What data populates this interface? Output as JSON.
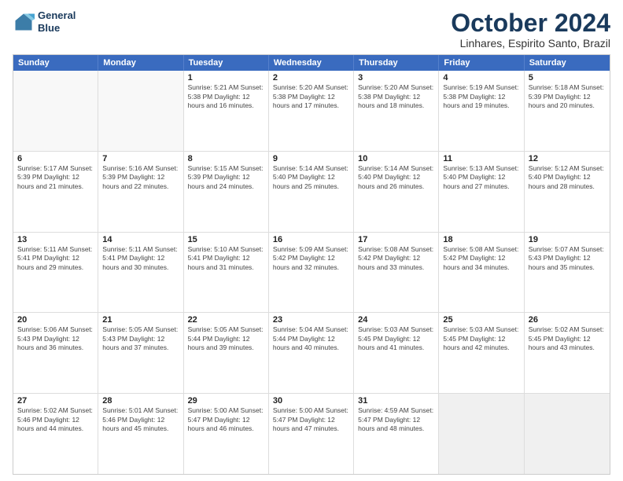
{
  "header": {
    "logo_line1": "General",
    "logo_line2": "Blue",
    "month": "October 2024",
    "location": "Linhares, Espirito Santo, Brazil"
  },
  "days_of_week": [
    "Sunday",
    "Monday",
    "Tuesday",
    "Wednesday",
    "Thursday",
    "Friday",
    "Saturday"
  ],
  "weeks": [
    [
      {
        "day": "",
        "info": "",
        "empty": true
      },
      {
        "day": "",
        "info": "",
        "empty": true
      },
      {
        "day": "1",
        "info": "Sunrise: 5:21 AM\nSunset: 5:38 PM\nDaylight: 12 hours\nand 16 minutes."
      },
      {
        "day": "2",
        "info": "Sunrise: 5:20 AM\nSunset: 5:38 PM\nDaylight: 12 hours\nand 17 minutes."
      },
      {
        "day": "3",
        "info": "Sunrise: 5:20 AM\nSunset: 5:38 PM\nDaylight: 12 hours\nand 18 minutes."
      },
      {
        "day": "4",
        "info": "Sunrise: 5:19 AM\nSunset: 5:38 PM\nDaylight: 12 hours\nand 19 minutes."
      },
      {
        "day": "5",
        "info": "Sunrise: 5:18 AM\nSunset: 5:39 PM\nDaylight: 12 hours\nand 20 minutes."
      }
    ],
    [
      {
        "day": "6",
        "info": "Sunrise: 5:17 AM\nSunset: 5:39 PM\nDaylight: 12 hours\nand 21 minutes."
      },
      {
        "day": "7",
        "info": "Sunrise: 5:16 AM\nSunset: 5:39 PM\nDaylight: 12 hours\nand 22 minutes."
      },
      {
        "day": "8",
        "info": "Sunrise: 5:15 AM\nSunset: 5:39 PM\nDaylight: 12 hours\nand 24 minutes."
      },
      {
        "day": "9",
        "info": "Sunrise: 5:14 AM\nSunset: 5:40 PM\nDaylight: 12 hours\nand 25 minutes."
      },
      {
        "day": "10",
        "info": "Sunrise: 5:14 AM\nSunset: 5:40 PM\nDaylight: 12 hours\nand 26 minutes."
      },
      {
        "day": "11",
        "info": "Sunrise: 5:13 AM\nSunset: 5:40 PM\nDaylight: 12 hours\nand 27 minutes."
      },
      {
        "day": "12",
        "info": "Sunrise: 5:12 AM\nSunset: 5:40 PM\nDaylight: 12 hours\nand 28 minutes."
      }
    ],
    [
      {
        "day": "13",
        "info": "Sunrise: 5:11 AM\nSunset: 5:41 PM\nDaylight: 12 hours\nand 29 minutes."
      },
      {
        "day": "14",
        "info": "Sunrise: 5:11 AM\nSunset: 5:41 PM\nDaylight: 12 hours\nand 30 minutes."
      },
      {
        "day": "15",
        "info": "Sunrise: 5:10 AM\nSunset: 5:41 PM\nDaylight: 12 hours\nand 31 minutes."
      },
      {
        "day": "16",
        "info": "Sunrise: 5:09 AM\nSunset: 5:42 PM\nDaylight: 12 hours\nand 32 minutes."
      },
      {
        "day": "17",
        "info": "Sunrise: 5:08 AM\nSunset: 5:42 PM\nDaylight: 12 hours\nand 33 minutes."
      },
      {
        "day": "18",
        "info": "Sunrise: 5:08 AM\nSunset: 5:42 PM\nDaylight: 12 hours\nand 34 minutes."
      },
      {
        "day": "19",
        "info": "Sunrise: 5:07 AM\nSunset: 5:43 PM\nDaylight: 12 hours\nand 35 minutes."
      }
    ],
    [
      {
        "day": "20",
        "info": "Sunrise: 5:06 AM\nSunset: 5:43 PM\nDaylight: 12 hours\nand 36 minutes."
      },
      {
        "day": "21",
        "info": "Sunrise: 5:05 AM\nSunset: 5:43 PM\nDaylight: 12 hours\nand 37 minutes."
      },
      {
        "day": "22",
        "info": "Sunrise: 5:05 AM\nSunset: 5:44 PM\nDaylight: 12 hours\nand 39 minutes."
      },
      {
        "day": "23",
        "info": "Sunrise: 5:04 AM\nSunset: 5:44 PM\nDaylight: 12 hours\nand 40 minutes."
      },
      {
        "day": "24",
        "info": "Sunrise: 5:03 AM\nSunset: 5:45 PM\nDaylight: 12 hours\nand 41 minutes."
      },
      {
        "day": "25",
        "info": "Sunrise: 5:03 AM\nSunset: 5:45 PM\nDaylight: 12 hours\nand 42 minutes."
      },
      {
        "day": "26",
        "info": "Sunrise: 5:02 AM\nSunset: 5:45 PM\nDaylight: 12 hours\nand 43 minutes."
      }
    ],
    [
      {
        "day": "27",
        "info": "Sunrise: 5:02 AM\nSunset: 5:46 PM\nDaylight: 12 hours\nand 44 minutes."
      },
      {
        "day": "28",
        "info": "Sunrise: 5:01 AM\nSunset: 5:46 PM\nDaylight: 12 hours\nand 45 minutes."
      },
      {
        "day": "29",
        "info": "Sunrise: 5:00 AM\nSunset: 5:47 PM\nDaylight: 12 hours\nand 46 minutes."
      },
      {
        "day": "30",
        "info": "Sunrise: 5:00 AM\nSunset: 5:47 PM\nDaylight: 12 hours\nand 47 minutes."
      },
      {
        "day": "31",
        "info": "Sunrise: 4:59 AM\nSunset: 5:47 PM\nDaylight: 12 hours\nand 48 minutes."
      },
      {
        "day": "",
        "info": "",
        "empty": true,
        "shaded": true
      },
      {
        "day": "",
        "info": "",
        "empty": true,
        "shaded": true
      }
    ]
  ]
}
